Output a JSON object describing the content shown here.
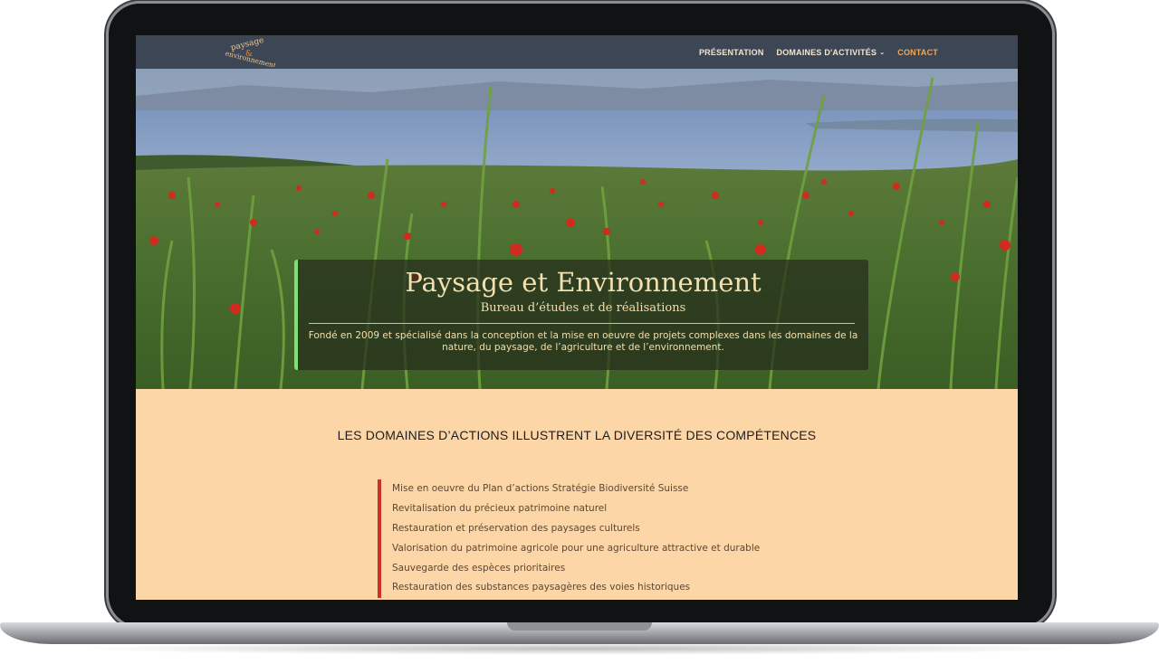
{
  "header": {
    "logo_text": [
      "paysage",
      "&",
      "environnement"
    ],
    "nav": [
      {
        "label": "PRÉSENTATION",
        "active": false,
        "has_dropdown": false
      },
      {
        "label": "DOMAINES D'ACTIVITÉS",
        "active": false,
        "has_dropdown": true
      },
      {
        "label": "CONTACT",
        "active": true,
        "has_dropdown": false
      }
    ]
  },
  "hero": {
    "title": "Paysage et Environnement",
    "subtitle": "Bureau d’études et de réalisations",
    "description": "Fondé en 2009 et spécialisé dans la conception et la mise en oeuvre de projets complexes dans les domaines de la nature, du paysage, de l’agriculture et de l’environnement."
  },
  "section": {
    "title": "LES DOMAINES D’ACTIONS ILLUSTRENT LA DIVERSITÉ DES COMPÉTENCES",
    "items": [
      "Mise en oeuvre du Plan d’actions Stratégie Biodiversité Suisse",
      "Revitalisation du précieux patrimoine naturel",
      "Restauration et préservation des paysages culturels",
      "Valorisation du patrimoine agricole pour une agriculture attractive et durable",
      "Sauvegarde des espèces prioritaires",
      "Restauration des substances paysagères des voies historiques"
    ]
  },
  "colors": {
    "header_bg": "#3d4654",
    "nav_active": "#f2a55a",
    "content_bg": "#fdd6a8",
    "hero_accent": "#7fe07a",
    "list_accent": "#c8322b"
  }
}
